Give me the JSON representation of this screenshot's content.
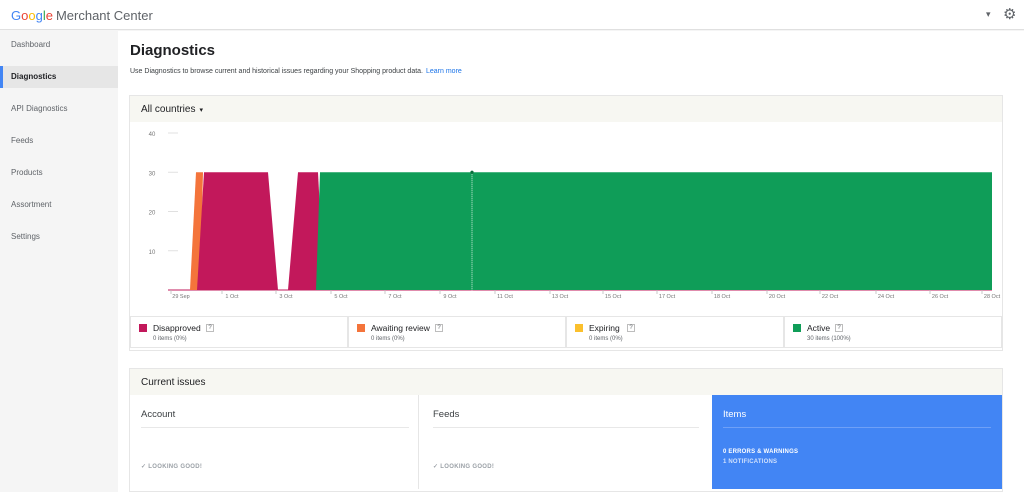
{
  "app": {
    "logo_google": [
      "G",
      "o",
      "o",
      "g",
      "l",
      "e"
    ],
    "logo_product": "Merchant Center"
  },
  "topbar": {
    "caret_glyph": "▾",
    "gear_glyph": "⚙"
  },
  "sidebar": {
    "items": [
      {
        "label": "Dashboard",
        "active": false
      },
      {
        "label": "Diagnostics",
        "active": true
      },
      {
        "label": "API Diagnostics",
        "active": false
      },
      {
        "label": "Feeds",
        "active": false
      },
      {
        "label": "Products",
        "active": false
      },
      {
        "label": "Assortment",
        "active": false
      },
      {
        "label": "Settings",
        "active": false
      }
    ]
  },
  "main": {
    "title": "Diagnostics",
    "intro": "Use Diagnostics to browse current and historical issues regarding your Shopping product data.",
    "learn_more": "Learn more",
    "country_filter": "All countries",
    "caret_glyph": "▾"
  },
  "chart_data": {
    "type": "area",
    "y_ticks": [
      10,
      20,
      30,
      40
    ],
    "ylim": [
      0,
      40
    ],
    "x_ticks": [
      "29 Sep",
      "1 Oct",
      "3 Oct",
      "5 Oct",
      "7 Oct",
      "9 Oct",
      "11 Oct",
      "13 Oct",
      "15 Oct",
      "17 Oct",
      "18 Oct",
      "20 Oct",
      "22 Oct",
      "24 Oct",
      "26 Oct",
      "28 Oct"
    ],
    "series": [
      {
        "name": "Disapproved",
        "color": "#c2185b"
      },
      {
        "name": "Awaiting review",
        "color": "#f4743b"
      },
      {
        "name": "Expiring",
        "color": "#fbc02d"
      },
      {
        "name": "Active",
        "color": "#0f9d58"
      }
    ],
    "peak_value": 30
  },
  "legend": [
    {
      "label": "Disapproved",
      "sub": "0 items (0%)",
      "color": "#c2185b",
      "help": "?"
    },
    {
      "label": "Awaiting review",
      "sub": "0 items (0%)",
      "color": "#f4743b",
      "help": "?"
    },
    {
      "label": "Expiring",
      "sub": "0 items (0%)",
      "color": "#fbc02d",
      "help": "?"
    },
    {
      "label": "Active",
      "sub": "30 items (100%)",
      "color": "#0f9d58",
      "help": "?"
    }
  ],
  "issues": {
    "title": "Current issues",
    "account": {
      "title": "Account",
      "status": "LOOKING GOOD!",
      "check": "✓"
    },
    "feeds": {
      "title": "Feeds",
      "status": "LOOKING GOOD!",
      "check": "✓"
    },
    "items": {
      "title": "Items",
      "row1": "0  ERRORS & WARNINGS",
      "row2": "1  NOTIFICATIONS"
    }
  }
}
